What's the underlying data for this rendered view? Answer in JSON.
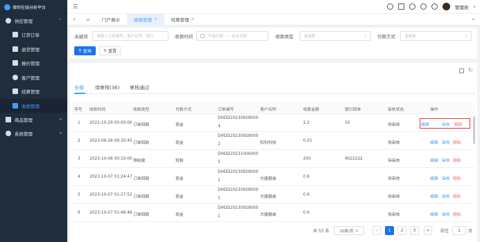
{
  "app": {
    "title": "律师在线分析平台"
  },
  "sidebar": {
    "items": [
      {
        "label": "供应管理",
        "type": "group",
        "chevron": "^"
      },
      {
        "label": "订货订单",
        "type": "sub"
      },
      {
        "label": "退货管理",
        "type": "sub"
      },
      {
        "label": "报价管理",
        "type": "sub"
      },
      {
        "label": "客户管理",
        "type": "sub"
      },
      {
        "label": "结算管理",
        "type": "sub"
      },
      {
        "label": "收款管理",
        "type": "sub",
        "active": true
      },
      {
        "label": "商品管理",
        "type": "group",
        "chevron": "v"
      },
      {
        "label": "系统管理",
        "type": "group",
        "chevron": "v"
      }
    ]
  },
  "topbar": {
    "user": "管理员"
  },
  "tabs": [
    {
      "label": "门户展示"
    },
    {
      "label": "收款管理",
      "active": true
    },
    {
      "label": "结算管理"
    }
  ],
  "filters": {
    "keyword_label": "关键词",
    "keyword_placeholder": "请输入订单编号、客户名称、银行",
    "time_label": "收款时间",
    "start_placeholder": "开始日期",
    "end_placeholder": "结束日期",
    "range_sep": "-",
    "type_label": "收款类型",
    "type_placeholder": "请选择",
    "pay_label": "付款方式",
    "pay_placeholder": "请选择",
    "search_label": "查询",
    "reset_label": "重置"
  },
  "status_tabs": [
    {
      "label": "全部",
      "active": true
    },
    {
      "label": "待审核(36)"
    },
    {
      "label": "审核通过"
    }
  ],
  "table": {
    "columns": [
      "序号",
      "收款时间",
      "收款类型",
      "付款方式",
      "订单编号",
      "客户名称",
      "收款金额",
      "银行回单",
      "审核状态",
      "操作"
    ],
    "rows": [
      {
        "idx": "1",
        "time": "2022-10-29 00:00:00",
        "type": "订单回款",
        "pay": "现金",
        "order": [
          "DHDD20230928000",
          "4"
        ],
        "customer": "",
        "amount": "2.2",
        "receipt": "10",
        "status": "待审核"
      },
      {
        "idx": "2",
        "time": "2023-09-28 09:30:45",
        "type": "订单回款",
        "pay": "现金",
        "order": [
          "DHDD20230928000",
          "2"
        ],
        "customer": "阳钊科技",
        "amount": "0.01",
        "receipt": "",
        "status": "待审核"
      },
      {
        "idx": "3",
        "time": "2023-10-06 00:10:00",
        "type": "预收款",
        "pay": "转账",
        "order": [
          "DHDD20231006000",
          "5"
        ],
        "customer": "",
        "amount": "200",
        "receipt": "4022222",
        "status": "待审核"
      },
      {
        "idx": "4",
        "time": "2023-10-07 01:24:47",
        "type": "订单回款",
        "pay": "现金",
        "order": [
          "DHDD20230928000",
          "1"
        ],
        "customer": "大唐服装",
        "amount": "0.6",
        "receipt": "",
        "status": "待审核"
      },
      {
        "idx": "5",
        "time": "2023-10-07 01:27:52",
        "type": "订单回款",
        "pay": "现金",
        "order": [
          "DHDD20230928000",
          "1"
        ],
        "customer": "大唐服装",
        "amount": "0.6",
        "receipt": "",
        "status": "待审核"
      },
      {
        "idx": "6",
        "time": "2023-10-07 01:46:46",
        "type": "订单回款",
        "pay": "现金",
        "order": [
          "DHDD20230928000",
          "1"
        ],
        "customer": "大唐服装",
        "amount": "0.6",
        "receipt": "",
        "status": "待审核"
      }
    ],
    "actions": {
      "edit": "编辑",
      "audit": "审核",
      "delete": "删除"
    }
  },
  "pagination": {
    "total": "共 55 条",
    "page_size": "20条/页",
    "pages": [
      "1",
      "2",
      "3"
    ],
    "current": "1",
    "prev": "<",
    "next": ">",
    "goto_label": "前往",
    "goto_value": "1",
    "goto_suffix": "页"
  },
  "colors": {
    "sidebar_bg": "#1f2d3d",
    "primary": "#409eff",
    "danger": "#f56c6c",
    "highlight_border": "#e53935"
  }
}
